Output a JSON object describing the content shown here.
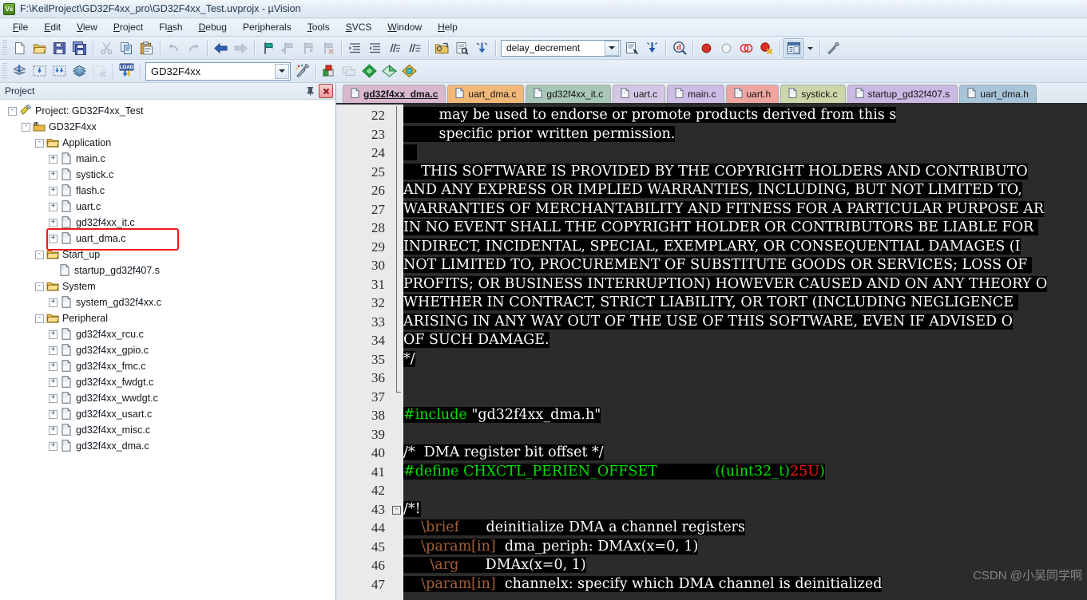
{
  "window": {
    "title": "F:\\KeilProject\\GD32F4xx_pro\\GD32F4xx_Test.uvprojx - µVision",
    "logo_text": "Vs"
  },
  "menubar": {
    "items": [
      {
        "label": "File",
        "mnemonic": "F"
      },
      {
        "label": "Edit",
        "mnemonic": "E"
      },
      {
        "label": "View",
        "mnemonic": "V"
      },
      {
        "label": "Project",
        "mnemonic": "P"
      },
      {
        "label": "Flash",
        "mnemonic": "a"
      },
      {
        "label": "Debug",
        "mnemonic": "D"
      },
      {
        "label": "Peripherals",
        "mnemonic": "i"
      },
      {
        "label": "Tools",
        "mnemonic": "T"
      },
      {
        "label": "SVCS",
        "mnemonic": "S"
      },
      {
        "label": "Window",
        "mnemonic": "W"
      },
      {
        "label": "Help",
        "mnemonic": "H"
      }
    ]
  },
  "toolbar_main": {
    "buttons": [
      {
        "name": "new-file-icon",
        "tip": "New"
      },
      {
        "name": "open-file-icon",
        "tip": "Open"
      },
      {
        "name": "save-icon",
        "tip": "Save"
      },
      {
        "name": "save-all-icon",
        "tip": "Save All"
      },
      {
        "name": "cut-icon",
        "tip": "Cut"
      },
      {
        "name": "copy-icon",
        "tip": "Copy"
      },
      {
        "name": "paste-icon",
        "tip": "Paste"
      },
      {
        "name": "undo-icon",
        "tip": "Undo"
      },
      {
        "name": "redo-icon",
        "tip": "Redo"
      },
      {
        "name": "navigate-back-icon",
        "tip": "Back"
      },
      {
        "name": "navigate-forward-icon",
        "tip": "Forward"
      },
      {
        "name": "bookmark-toggle-icon",
        "tip": "Insert/Remove Bookmark"
      },
      {
        "name": "bookmark-prev-icon",
        "tip": "Previous Bookmark"
      },
      {
        "name": "bookmark-next-icon",
        "tip": "Next Bookmark"
      },
      {
        "name": "bookmark-clear-icon",
        "tip": "Clear All Bookmarks"
      },
      {
        "name": "indent-icon",
        "tip": "Indent"
      },
      {
        "name": "outdent-icon",
        "tip": "Outdent"
      },
      {
        "name": "comment-icon",
        "tip": "Comment"
      },
      {
        "name": "uncomment-icon",
        "tip": "Uncomment"
      }
    ],
    "find_combo_value": "delay_decrement",
    "right_buttons": [
      {
        "name": "find-in-files-icon",
        "tip": "Find in Files"
      },
      {
        "name": "incremental-find-icon",
        "tip": "Incremental Find"
      },
      {
        "name": "browse-symbol-icon",
        "tip": "Browse Symbol"
      },
      {
        "name": "breakpoint-insert-icon",
        "tip": "Insert/Remove Breakpoint"
      },
      {
        "name": "breakpoint-enable-icon",
        "tip": "Enable/Disable Breakpoint"
      },
      {
        "name": "breakpoint-disable-all-icon",
        "tip": "Disable All Breakpoints"
      },
      {
        "name": "breakpoint-kill-all-icon",
        "tip": "Kill All Breakpoints"
      },
      {
        "name": "project-window-icon",
        "tip": "Project Window"
      },
      {
        "name": "configure-icon",
        "tip": "Configuration Wizard"
      }
    ]
  },
  "toolbar_build": {
    "buttons": [
      {
        "name": "translate-icon",
        "tip": "Translate current file"
      },
      {
        "name": "build-icon",
        "tip": "Build"
      },
      {
        "name": "rebuild-icon",
        "tip": "Rebuild all target files"
      },
      {
        "name": "batch-build-icon",
        "tip": "Batch Build"
      },
      {
        "name": "stop-build-icon",
        "tip": "Stop Build"
      },
      {
        "name": "download-icon",
        "tip": "Download"
      }
    ],
    "target_value": "GD32F4xx",
    "right_buttons": [
      {
        "name": "target-options-icon",
        "tip": "Options for Target"
      },
      {
        "name": "manage-project-items-icon",
        "tip": "Manage Project Items"
      },
      {
        "name": "pack-installer-icon",
        "tip": "Pack Installer"
      },
      {
        "name": "manage-rte-icon",
        "tip": "Manage Run-Time Environment"
      },
      {
        "name": "select-software-packs-icon",
        "tip": "Select Software Packs"
      }
    ]
  },
  "project_panel": {
    "title": "Project",
    "pin_icon": "pin-icon",
    "close_icon": "close-icon",
    "highlighted_item": "uart_dma.c",
    "tree": [
      {
        "depth": 0,
        "label": "Project: GD32F4xx_Test",
        "icon": "project-icon",
        "expander": "-"
      },
      {
        "depth": 1,
        "label": "GD32F4xx",
        "icon": "target-icon",
        "expander": "-"
      },
      {
        "depth": 2,
        "label": "Application",
        "icon": "folder-icon",
        "expander": "-"
      },
      {
        "depth": 3,
        "label": "main.c",
        "icon": "c-file-icon",
        "expander": "+"
      },
      {
        "depth": 3,
        "label": "systick.c",
        "icon": "c-file-icon",
        "expander": "+"
      },
      {
        "depth": 3,
        "label": "flash.c",
        "icon": "c-file-icon",
        "expander": "+"
      },
      {
        "depth": 3,
        "label": "uart.c",
        "icon": "c-file-icon",
        "expander": "+"
      },
      {
        "depth": 3,
        "label": "gd32f4xx_it.c",
        "icon": "c-file-icon",
        "expander": "+"
      },
      {
        "depth": 3,
        "label": "uart_dma.c",
        "icon": "c-file-icon",
        "expander": "+"
      },
      {
        "depth": 2,
        "label": "Start_up",
        "icon": "folder-icon",
        "expander": "-"
      },
      {
        "depth": 3,
        "label": "startup_gd32f407.s",
        "icon": "asm-file-icon",
        "expander": ""
      },
      {
        "depth": 2,
        "label": "System",
        "icon": "folder-icon",
        "expander": "-"
      },
      {
        "depth": 3,
        "label": "system_gd32f4xx.c",
        "icon": "c-file-icon",
        "expander": "+"
      },
      {
        "depth": 2,
        "label": "Peripheral",
        "icon": "folder-icon",
        "expander": "-"
      },
      {
        "depth": 3,
        "label": "gd32f4xx_rcu.c",
        "icon": "c-file-icon",
        "expander": "+"
      },
      {
        "depth": 3,
        "label": "gd32f4xx_gpio.c",
        "icon": "c-file-icon",
        "expander": "+"
      },
      {
        "depth": 3,
        "label": "gd32f4xx_fmc.c",
        "icon": "c-file-icon",
        "expander": "+"
      },
      {
        "depth": 3,
        "label": "gd32f4xx_fwdgt.c",
        "icon": "c-file-icon",
        "expander": "+"
      },
      {
        "depth": 3,
        "label": "gd32f4xx_wwdgt.c",
        "icon": "c-file-icon",
        "expander": "+"
      },
      {
        "depth": 3,
        "label": "gd32f4xx_usart.c",
        "icon": "c-file-icon",
        "expander": "+"
      },
      {
        "depth": 3,
        "label": "gd32f4xx_misc.c",
        "icon": "c-file-icon",
        "expander": "+"
      },
      {
        "depth": 3,
        "label": "gd32f4xx_dma.c",
        "icon": "c-file-icon",
        "expander": "+"
      }
    ]
  },
  "editor": {
    "tabs": [
      {
        "label": "gd32f4xx_dma.c",
        "color": "#d9b8cf",
        "selected": true
      },
      {
        "label": "uart_dma.c",
        "color": "#f2b878",
        "selected": false
      },
      {
        "label": "gd32f4xx_it.c",
        "color": "#a8c7b6",
        "selected": false
      },
      {
        "label": "uart.c",
        "color": "#d4c7e6",
        "selected": false
      },
      {
        "label": "main.c",
        "color": "#cdbde6",
        "selected": false
      },
      {
        "label": "uart.h",
        "color": "#f0a6a0",
        "selected": false
      },
      {
        "label": "systick.c",
        "color": "#cdd6a8",
        "selected": false
      },
      {
        "label": "startup_gd32f407.s",
        "color": "#cbb9e4",
        "selected": false
      },
      {
        "label": "uart_dma.h",
        "color": "#a8c4d8",
        "selected": false
      }
    ],
    "first_line_number": 22,
    "watermark": "CSDN @小吴同学啊",
    "lines": [
      {
        "n": 22,
        "tokens": [
          {
            "t": "        may be used to endorse or promote products derived from this s",
            "c": "tk-wht"
          }
        ]
      },
      {
        "n": 23,
        "tokens": [
          {
            "t": "        specific prior written permission.",
            "c": "tk-wht"
          }
        ]
      },
      {
        "n": 24,
        "tokens": [
          {
            "t": "   ",
            "c": "tk-wht"
          }
        ]
      },
      {
        "n": 25,
        "tokens": [
          {
            "t": "    THIS SOFTWARE IS PROVIDED BY THE COPYRIGHT HOLDERS AND CONTRIBUTO",
            "c": "tk-wht"
          }
        ]
      },
      {
        "n": 26,
        "tokens": [
          {
            "t": "AND ANY EXPRESS OR IMPLIED WARRANTIES, INCLUDING, BUT NOT LIMITED TO,",
            "c": "tk-wht"
          }
        ]
      },
      {
        "n": 27,
        "tokens": [
          {
            "t": "WARRANTIES OF MERCHANTABILITY AND FITNESS FOR A PARTICULAR PURPOSE AR",
            "c": "tk-wht"
          }
        ]
      },
      {
        "n": 28,
        "tokens": [
          {
            "t": "IN NO EVENT SHALL THE COPYRIGHT HOLDER OR CONTRIBUTORS BE LIABLE FOR ",
            "c": "tk-wht"
          }
        ]
      },
      {
        "n": 29,
        "tokens": [
          {
            "t": "INDIRECT, INCIDENTAL, SPECIAL, EXEMPLARY, OR CONSEQUENTIAL DAMAGES (I",
            "c": "tk-wht"
          }
        ]
      },
      {
        "n": 30,
        "tokens": [
          {
            "t": "NOT LIMITED TO, PROCUREMENT OF SUBSTITUTE GOODS OR SERVICES; LOSS OF ",
            "c": "tk-wht"
          }
        ]
      },
      {
        "n": 31,
        "tokens": [
          {
            "t": "PROFITS; OR BUSINESS INTERRUPTION) HOWEVER CAUSED AND ON ANY THEORY O",
            "c": "tk-wht"
          }
        ]
      },
      {
        "n": 32,
        "tokens": [
          {
            "t": "WHETHER IN CONTRACT, STRICT LIABILITY, OR TORT (INCLUDING NEGLIGENCE ",
            "c": "tk-wht"
          }
        ]
      },
      {
        "n": 33,
        "tokens": [
          {
            "t": "ARISING IN ANY WAY OUT OF THE USE OF THIS SOFTWARE, EVEN IF ADVISED O",
            "c": "tk-wht"
          }
        ]
      },
      {
        "n": 34,
        "tokens": [
          {
            "t": "OF SUCH DAMAGE.",
            "c": "tk-wht"
          }
        ]
      },
      {
        "n": 35,
        "tokens": [
          {
            "t": "*/",
            "c": "tk-wht"
          }
        ]
      },
      {
        "n": 36,
        "tokens": []
      },
      {
        "n": 37,
        "tokens": []
      },
      {
        "n": 38,
        "tokens": [
          {
            "t": "#include",
            "c": "tk-grn"
          },
          {
            "t": " ",
            "c": "tk-wht"
          },
          {
            "t": "\"gd32f4xx_dma.h\"",
            "c": "tk-wht"
          }
        ]
      },
      {
        "n": 39,
        "tokens": []
      },
      {
        "n": 40,
        "tokens": [
          {
            "t": "/*  DMA register bit offset */",
            "c": "tk-wht"
          }
        ]
      },
      {
        "n": 41,
        "tokens": [
          {
            "t": "#define",
            "c": "tk-grn"
          },
          {
            "t": " ",
            "c": "tk-wht"
          },
          {
            "t": "CHXCTL_PERIEN_OFFSET",
            "c": "tk-grn"
          },
          {
            "t": "             ",
            "c": "tk-wht"
          },
          {
            "t": "((uint32_t)",
            "c": "tk-grn"
          },
          {
            "t": "25U",
            "c": "tk-red"
          },
          {
            "t": ")",
            "c": "tk-grn"
          }
        ]
      },
      {
        "n": 42,
        "tokens": []
      },
      {
        "n": 43,
        "tokens": [
          {
            "t": "/*!",
            "c": "tk-wht"
          }
        ],
        "fold": true
      },
      {
        "n": 44,
        "tokens": [
          {
            "t": "    \\brief",
            "c": "tk-doc"
          },
          {
            "t": "      deinitialize DMA a channel registers",
            "c": "tk-wht"
          }
        ]
      },
      {
        "n": 45,
        "tokens": [
          {
            "t": "    \\param[in]",
            "c": "tk-doc"
          },
          {
            "t": "  dma_periph: DMAx(x=0, 1)",
            "c": "tk-wht"
          }
        ]
      },
      {
        "n": 46,
        "tokens": [
          {
            "t": "      \\arg",
            "c": "tk-doc"
          },
          {
            "t": "      DMAx(x=0, 1)",
            "c": "tk-wht"
          }
        ]
      },
      {
        "n": 47,
        "tokens": [
          {
            "t": "    \\param[in]",
            "c": "tk-doc"
          },
          {
            "t": "  channelx: specify which DMA channel is deinitialized",
            "c": "tk-wht"
          }
        ]
      }
    ]
  }
}
